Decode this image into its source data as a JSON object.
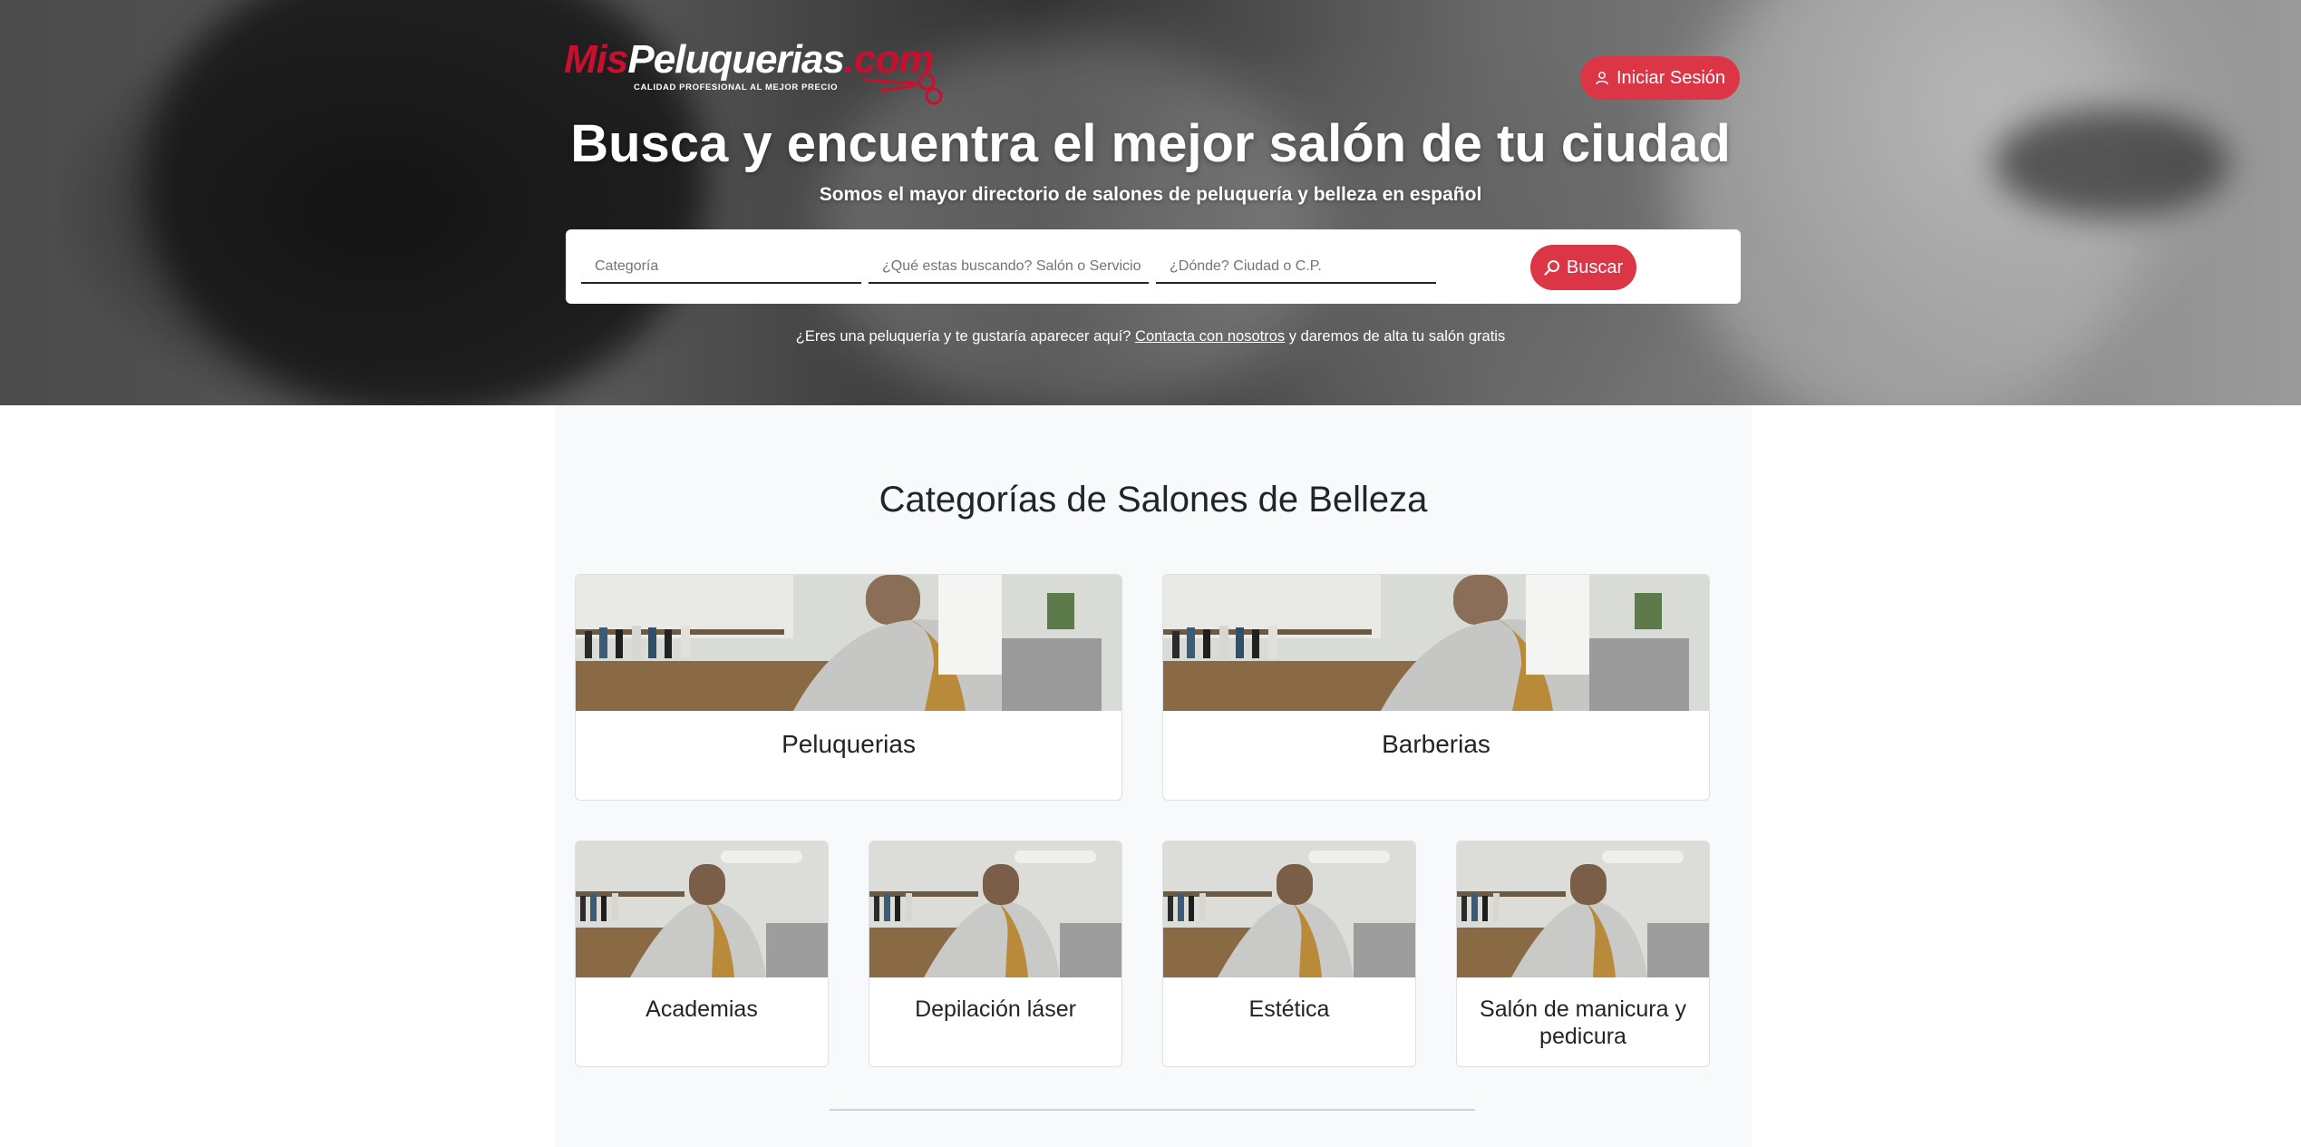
{
  "brand": {
    "logo_part_1": "Mis",
    "logo_part_2": "Peluquerias",
    "logo_part_3": ".com",
    "tagline": "CALIDAD PROFESIONAL AL MEJOR PRECIO",
    "accent_color": "#dc3545"
  },
  "header": {
    "login_label": "Iniciar Sesión",
    "login_icon": "user-icon"
  },
  "hero": {
    "title": "Busca y encuentra el mejor salón de tu ciudad",
    "subtitle": "Somos el mayor directorio de salones de peluquería y belleza en español"
  },
  "search": {
    "category_placeholder": "Categoría",
    "what_placeholder": "¿Qué estas buscando? Salón o Servicio",
    "where_placeholder": "¿Dónde? Ciudad o C.P.",
    "button_label": "Buscar",
    "button_icon": "search-icon"
  },
  "note": {
    "before": "¿Eres una peluquería y te gustaría aparecer aquí?",
    "link": "Contacta con nosotros",
    "after": "y daremos de alta tu salón gratis"
  },
  "categories": {
    "title": "Categorías de Salones de Belleza",
    "items": [
      {
        "label": "Peluquerias"
      },
      {
        "label": "Barberias"
      },
      {
        "label": "Academias"
      },
      {
        "label": "Depilación láser"
      },
      {
        "label": "Estética"
      },
      {
        "label": "Salón de manicura y pedicura"
      }
    ]
  }
}
